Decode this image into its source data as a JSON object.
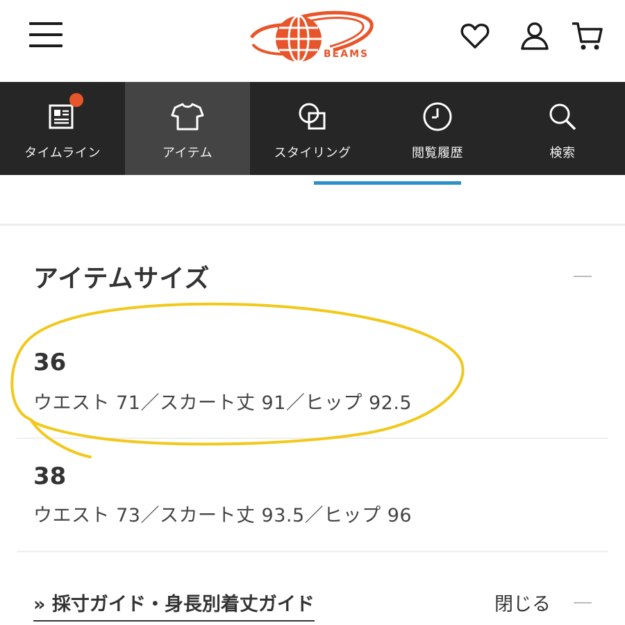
{
  "brand": {
    "logo_text": "BEAMS",
    "accent_color": "#e8552a"
  },
  "header": {
    "icons": [
      "menu-icon",
      "heart-icon",
      "user-icon",
      "cart-icon"
    ]
  },
  "nav": {
    "items": [
      {
        "label": "タイムライン",
        "icon": "timeline-icon",
        "has_notification": true
      },
      {
        "label": "アイテム",
        "icon": "tshirt-icon",
        "active": true
      },
      {
        "label": "スタイリング",
        "icon": "styling-icon"
      },
      {
        "label": "閲覧履歴",
        "icon": "clock-icon"
      },
      {
        "label": "検索",
        "icon": "search-icon"
      }
    ],
    "bg_color": "#262626",
    "active_bg_color": "#444444",
    "indicator_color": "#2b8fc9"
  },
  "section": {
    "title": "アイテムサイズ",
    "sizes": [
      {
        "size": "36",
        "measurements": "ウエスト 71／スカート丈 91／ヒップ 92.5"
      },
      {
        "size": "38",
        "measurements": "ウエスト 73／スカート丈 93.5／ヒップ 96"
      }
    ],
    "guide_link": "» 採寸ガイド・身長別着丈ガイド",
    "close_label": "閉じる"
  },
  "annotation_color": "#f2c81a"
}
